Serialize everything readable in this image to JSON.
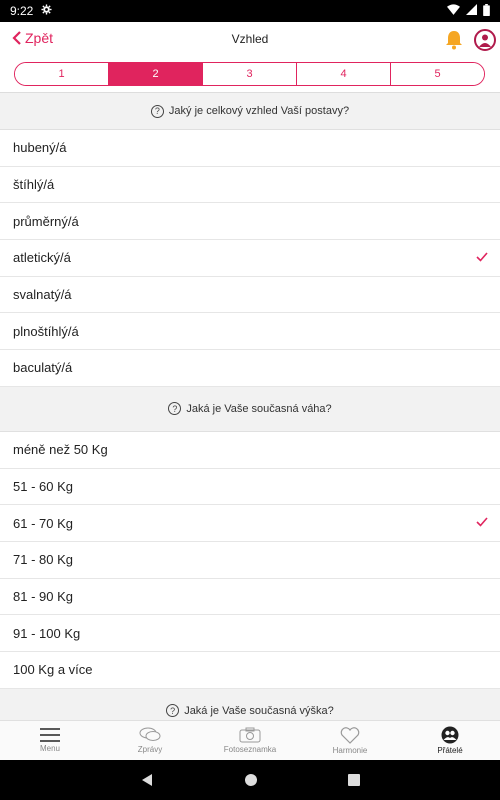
{
  "status": {
    "time": "9:22"
  },
  "nav": {
    "back_label": "Zpět",
    "title": "Vzhled"
  },
  "stepper": [
    "1",
    "2",
    "3",
    "4",
    "5"
  ],
  "stepper_active": 1,
  "sections": [
    {
      "question": "Jaký je celkový vzhled Vaší postavy?",
      "options": [
        "hubený/á",
        "štíhlý/á",
        "průměrný/á",
        "atletický/á",
        "svalnatý/á",
        "plnoštíhlý/á",
        "baculatý/á"
      ],
      "selected_index": 3
    },
    {
      "question": "Jaká je Vaše současná váha?",
      "options": [
        "méně než 50 Kg",
        "51 - 60 Kg",
        "61 - 70 Kg",
        "71 - 80 Kg",
        "81 - 90 Kg",
        "91 - 100 Kg",
        "100 Kg a více"
      ],
      "selected_index": 2
    },
    {
      "question": "Jaká je Vaše současná výška?"
    }
  ],
  "tabbar": [
    "Menu",
    "Zprávy",
    "Fotoseznamka",
    "Harmonie",
    "Přátelé"
  ],
  "tabbar_active": 4,
  "colors": {
    "accent": "#e0245e",
    "bell": "#f5a623"
  }
}
